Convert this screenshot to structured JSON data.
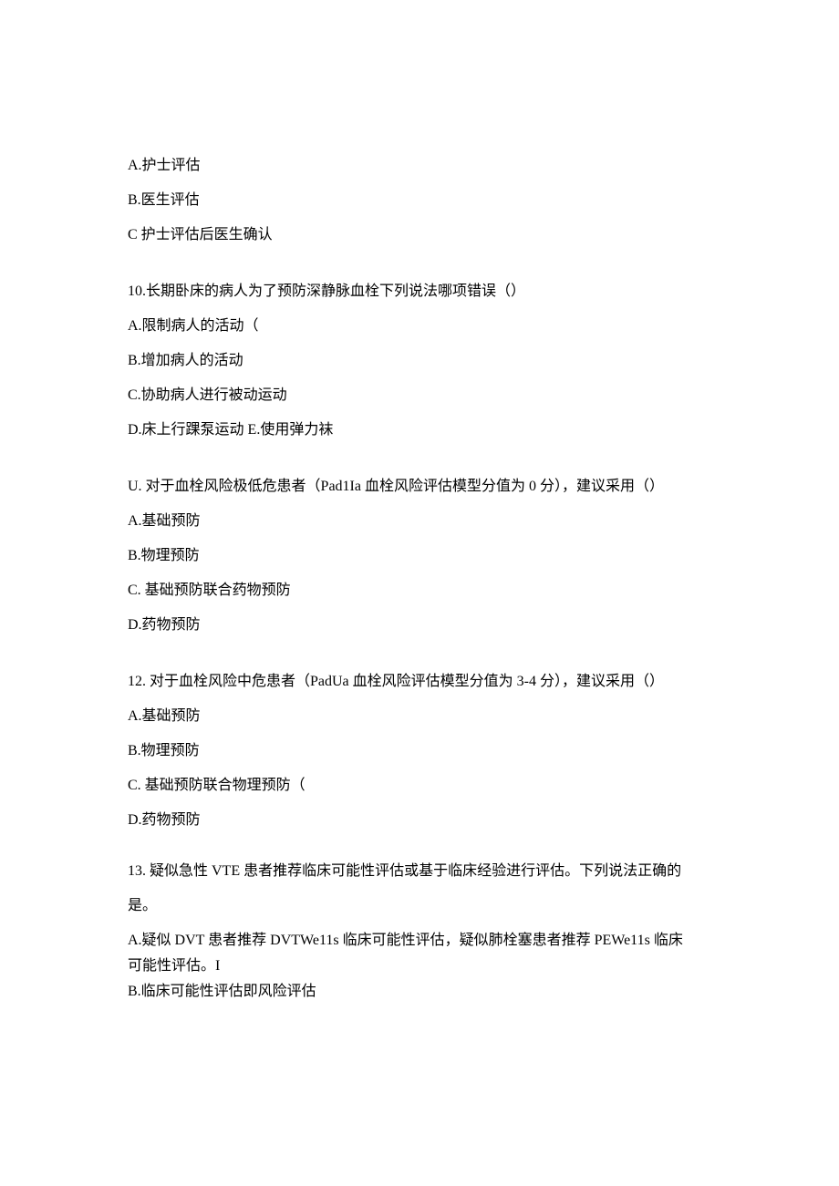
{
  "q9_partial": {
    "optA": "A.护士评估",
    "optB": "B.医生评估",
    "optC": "C 护士评估后医生确认"
  },
  "q10": {
    "question": "10.长期卧床的病人为了预防深静脉血栓下列说法哪项错误（）",
    "optA": "A.限制病人的活动（",
    "optB": "B.增加病人的活动",
    "optC": "C.协助病人进行被动运动",
    "optD": "D.床上行踝泵运动 E.使用弹力袜"
  },
  "q11": {
    "question": "U. 对于血栓风险极低危患者（Pad1Ia 血栓风险评估模型分值为 0 分），建议采用（）",
    "optA": "A.基础预防",
    "optB": "B.物理预防",
    "optC": "C. 基础预防联合药物预防",
    "optD": "D.药物预防"
  },
  "q12": {
    "question": "12. 对于血栓风险中危患者（PadUa 血栓风险评估模型分值为 3-4 分），建议采用（）",
    "optA": "A.基础预防",
    "optB": "B.物理预防",
    "optC": "C. 基础预防联合物理预防（",
    "optD": "D.药物预防"
  },
  "q13": {
    "question_l1": "13. 疑似急性 VTE 患者推荐临床可能性评估或基于临床经验进行评估。下列说法正确的",
    "question_l2": "是。",
    "optA_l1": "A.疑似 DVT 患者推荐 DVTWe11s 临床可能性评估，疑似肺栓塞患者推荐 PEWe11s 临床",
    "optA_l2": "可能性评估。I",
    "optB": "B.临床可能性评估即风险评估"
  }
}
